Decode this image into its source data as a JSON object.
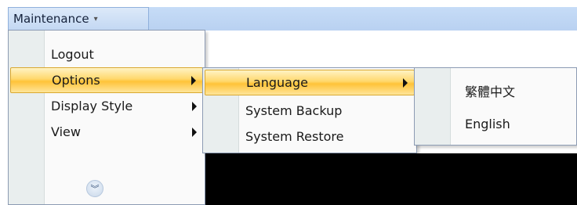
{
  "menubar": {
    "maintenance_label": "Maintenance",
    "dropdown_glyph": "▾"
  },
  "main_menu": {
    "items": [
      {
        "label": "Logout",
        "has_submenu": false,
        "highlighted": false
      },
      {
        "label": "Options",
        "has_submenu": true,
        "highlighted": true
      },
      {
        "label": "Display Style",
        "has_submenu": true,
        "highlighted": false
      },
      {
        "label": "View",
        "has_submenu": true,
        "highlighted": false
      }
    ],
    "expand_glyph": "︾",
    "expand_icon": "double-chevron-down-icon"
  },
  "options_submenu": {
    "items": [
      {
        "label": "Language",
        "has_submenu": true,
        "highlighted": true
      },
      {
        "label": "System Backup",
        "has_submenu": false,
        "highlighted": false
      },
      {
        "label": "System Restore",
        "has_submenu": false,
        "highlighted": false
      }
    ]
  },
  "language_submenu": {
    "items": [
      {
        "label": "繁體中文"
      },
      {
        "label": "English"
      }
    ]
  },
  "colors": {
    "ribbon": "#c6dcf7",
    "highlight": "#ffd86c",
    "menu_bg": "#fafafa",
    "gutter": "#e9eeee"
  }
}
